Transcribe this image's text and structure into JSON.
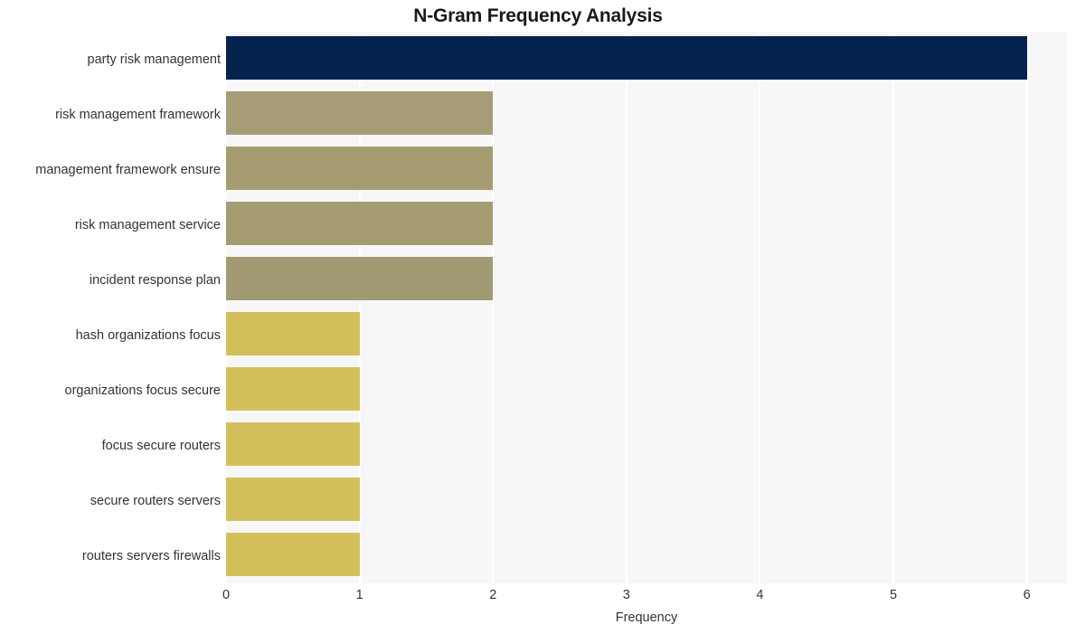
{
  "chart_data": {
    "type": "bar",
    "orientation": "horizontal",
    "title": "N-Gram Frequency Analysis",
    "xlabel": "Frequency",
    "ylabel": "",
    "xlim": [
      0,
      6.3
    ],
    "xticks": [
      0,
      1,
      2,
      3,
      4,
      5,
      6
    ],
    "xtick_labels": [
      "0",
      "1",
      "2",
      "3",
      "4",
      "5",
      "6"
    ],
    "grid": "vertical-white-on-gray",
    "legend": "none",
    "categories": [
      "party risk management",
      "risk management framework",
      "management framework ensure",
      "risk management service",
      "incident response plan",
      "hash organizations focus",
      "organizations focus secure",
      "focus secure routers",
      "secure routers servers",
      "routers servers firewalls"
    ],
    "values": [
      6,
      2,
      2,
      2,
      2,
      1,
      1,
      1,
      1,
      1
    ],
    "bar_colors": [
      "#05234f",
      "#a69c76",
      "#a59c72",
      "#a59c72",
      "#a29a72",
      "#d3c05c",
      "#d3c05c",
      "#d3c05c",
      "#d3c05c",
      "#d3c05c"
    ],
    "plot_background": "#f7f7f7",
    "figure_background": "#ffffff",
    "text_color": "#333333",
    "title_color": "#1a1a1a"
  }
}
